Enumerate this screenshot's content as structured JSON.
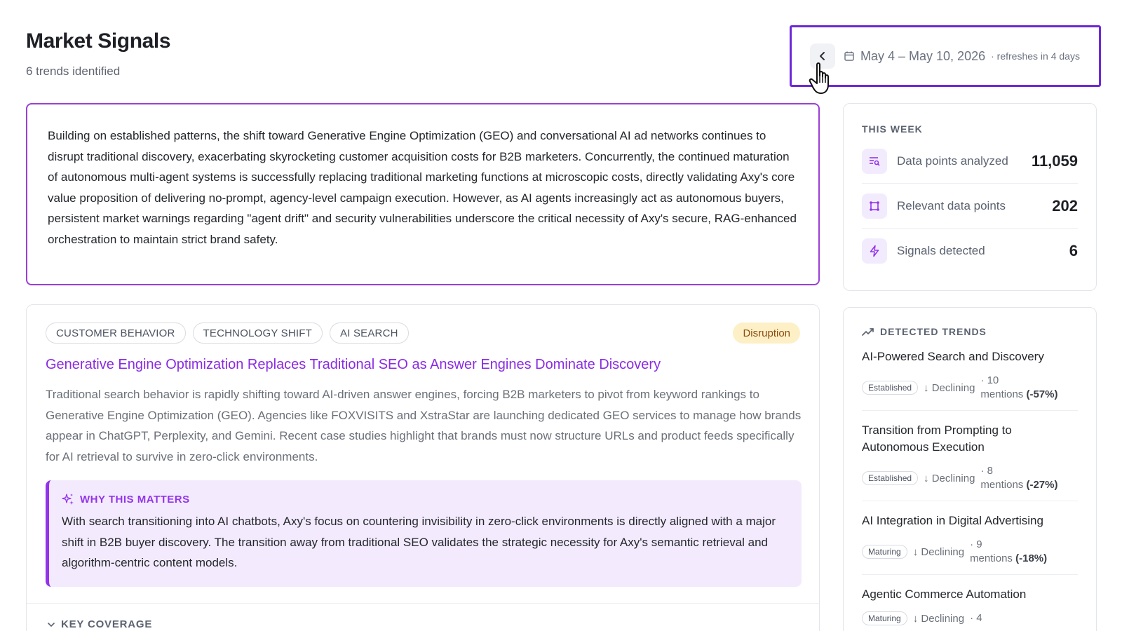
{
  "header": {
    "title": "Market Signals",
    "subtitle": "6 trends identified",
    "date_range": "May 4 – May 10, 2026",
    "refresh_note": "· refreshes in 4 days"
  },
  "summary": {
    "text": "Building on established patterns, the shift toward Generative Engine Optimization (GEO) and conversational AI ad networks continues to disrupt traditional discovery, exacerbating skyrocketing customer acquisition costs for B2B marketers. Concurrently, the continued maturation of autonomous multi-agent systems is successfully replacing traditional marketing functions at microscopic costs, directly validating Axy's core value proposition of delivering no-prompt, agency-level campaign execution. However, as AI agents increasingly act as autonomous buyers, persistent market warnings regarding \"agent drift\" and security vulnerabilities underscore the critical necessity of Axy's secure, RAG-enhanced orchestration to maintain strict brand safety."
  },
  "this_week": {
    "label": "THIS WEEK",
    "stats": [
      {
        "label": "Data points analyzed",
        "value": "11,059",
        "icon": "list-search-icon"
      },
      {
        "label": "Relevant data points",
        "value": "202",
        "icon": "frame-icon"
      },
      {
        "label": "Signals detected",
        "value": "6",
        "icon": "lightning-icon"
      }
    ]
  },
  "trend_article": {
    "tags": [
      "CUSTOMER BEHAVIOR",
      "TECHNOLOGY SHIFT",
      "AI SEARCH"
    ],
    "badge": "Disruption",
    "title": "Generative Engine Optimization Replaces Traditional SEO as Answer Engines Dominate Discovery",
    "body": "Traditional search behavior is rapidly shifting toward AI-driven answer engines, forcing B2B marketers to pivot from keyword rankings to Generative Engine Optimization (GEO). Agencies like FOXVISITS and XstraStar are launching dedicated GEO services to manage how brands appear in ChatGPT, Perplexity, and Gemini. Recent case studies highlight that brands must now structure URLs and product feeds specifically for AI retrieval to survive in zero-click environments.",
    "why_label": "WHY THIS MATTERS",
    "why_text": "With search transitioning into AI chatbots, Axy's focus on countering invisibility in zero-click environments is directly aligned with a major shift in B2B buyer discovery. The transition away from traditional SEO validates the strategic necessity for Axy's semantic retrieval and algorithm-centric content models.",
    "key_coverage_label": "KEY COVERAGE"
  },
  "detected_trends": {
    "label": "DETECTED TRENDS",
    "items": [
      {
        "title": "AI-Powered Search and Discovery",
        "stage": "Established",
        "direction": "↓ Declining",
        "mentions_count": "· 10",
        "mentions_word": "mentions",
        "change": "(-57%)"
      },
      {
        "title": "Transition from Prompting to Autonomous Execution",
        "stage": "Established",
        "direction": "↓ Declining",
        "mentions_count": "· 8",
        "mentions_word": "mentions",
        "change": "(-27%)"
      },
      {
        "title": "AI Integration in Digital Advertising",
        "stage": "Maturing",
        "direction": "↓ Declining",
        "mentions_count": "· 9",
        "mentions_word": "mentions",
        "change": "(-18%)"
      },
      {
        "title": "Agentic Commerce Automation",
        "stage": "Maturing",
        "direction": "↓ Declining",
        "mentions_count": "· 4",
        "mentions_word": "",
        "change": ""
      }
    ]
  },
  "colors": {
    "accent": "#9333ea",
    "highlight_border": "#6d28d9",
    "disruption_bg": "#fdf0c7"
  }
}
